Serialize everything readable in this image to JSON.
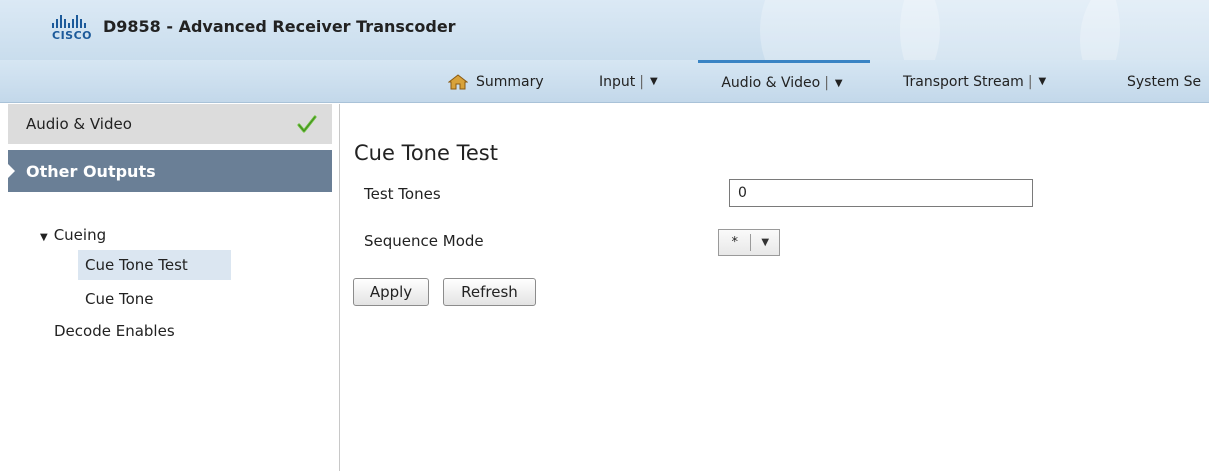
{
  "header": {
    "logo_text": "CISCO",
    "title": "D9858 - Advanced Receiver Transcoder"
  },
  "nav": {
    "items": [
      {
        "label": "Summary",
        "icon": "home-icon"
      },
      {
        "label": "Input",
        "sep": "|",
        "arrow": "▼"
      },
      {
        "label": "Audio & Video",
        "sep": "|",
        "arrow": "▼",
        "active": true
      },
      {
        "label": "Transport Stream",
        "sep": "|",
        "arrow": "▼"
      },
      {
        "label": "System Se"
      }
    ]
  },
  "sidebar": {
    "header_label": "Audio & Video",
    "section_label": "Other Outputs",
    "tree": {
      "cueing": "Cueing",
      "cue_tone_test": "Cue Tone Test",
      "cue_tone": "Cue Tone",
      "decode_enables": "Decode Enables"
    }
  },
  "main": {
    "title": "Cue Tone Test",
    "test_tones_label": "Test Tones",
    "test_tones_value": "0",
    "sequence_mode_label": "Sequence Mode",
    "sequence_mode_value": "*",
    "apply_label": "Apply",
    "refresh_label": "Refresh"
  },
  "colors": {
    "header_bg": "#d3e4f2",
    "active_tab_accent": "#3a84c4",
    "section_bg": "#6a7f96",
    "selected_bg": "#dbe6f1",
    "check_green": "#6abf3b"
  }
}
